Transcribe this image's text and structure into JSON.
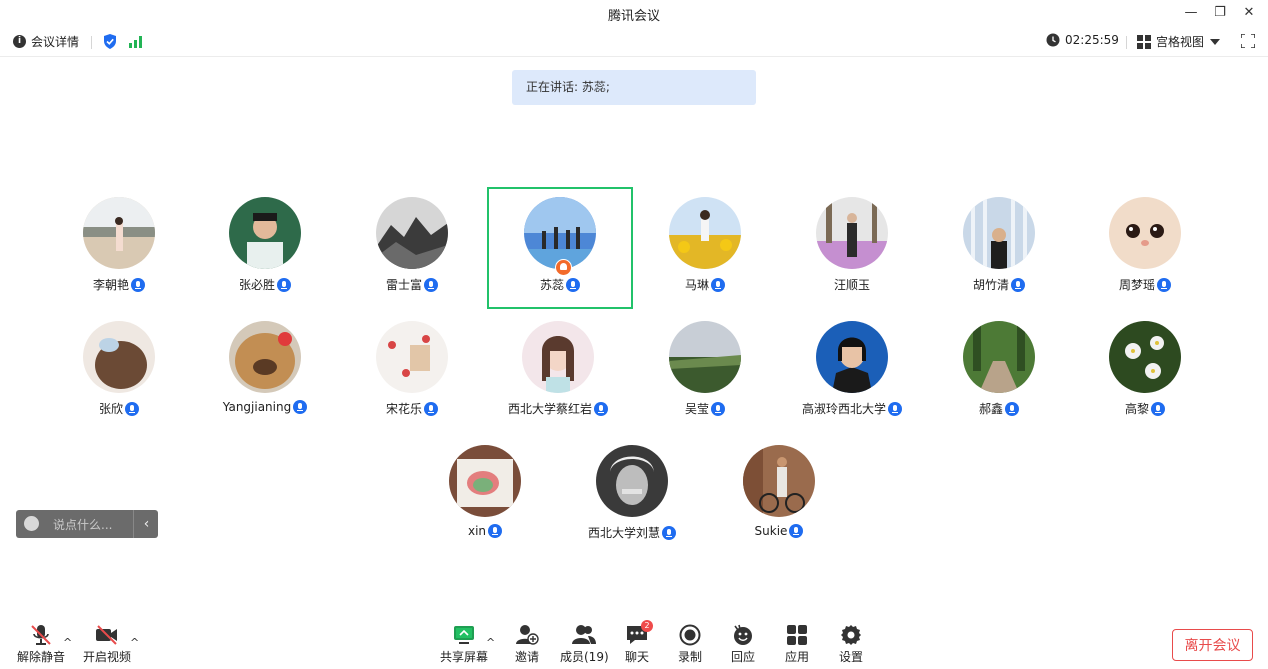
{
  "window": {
    "title": "腾讯会议",
    "minimize": "—",
    "restore": "❐",
    "close": "✕"
  },
  "infobar": {
    "details_label": "会议详情",
    "timer": "02:25:59",
    "view_label": "宫格视图",
    "colors": {
      "shield": "#1f6cf0",
      "signal": "#22b455"
    }
  },
  "speaking": {
    "text": "正在讲话: 苏蕊;"
  },
  "participants": [
    {
      "name": "李朝艳",
      "mic": true
    },
    {
      "name": "张必胜",
      "mic": true
    },
    {
      "name": "雷士富",
      "mic": true
    },
    {
      "name": "苏蕊",
      "mic": true,
      "host": true,
      "active": true
    },
    {
      "name": "马琳",
      "mic": true
    },
    {
      "name": "汪顺玉",
      "mic": false
    },
    {
      "name": "胡竹清",
      "mic": true
    },
    {
      "name": "周梦瑶",
      "mic": true
    },
    {
      "name": "张欣",
      "mic": true
    },
    {
      "name": "Yangjianing",
      "mic": true
    },
    {
      "name": "宋花乐",
      "mic": true
    },
    {
      "name": "西北大学蔡红岩",
      "mic": true
    },
    {
      "name": "吴莹",
      "mic": true
    },
    {
      "name": "高淑玲西北大学",
      "mic": true
    },
    {
      "name": "郝鑫",
      "mic": true
    },
    {
      "name": "高黎",
      "mic": true
    },
    {
      "name": "xin",
      "mic": true
    },
    {
      "name": "西北大学刘慧",
      "mic": true
    },
    {
      "name": "Sukie",
      "mic": true
    }
  ],
  "chat": {
    "placeholder": "说点什么...",
    "collapse": "‹"
  },
  "toolbar": {
    "unmute": "解除静音",
    "start_video": "开启视频",
    "share": "共享屏幕",
    "invite": "邀请",
    "members": "成员(19)",
    "chat": "聊天",
    "chat_badge": "2",
    "record": "录制",
    "react": "回应",
    "apps": "应用",
    "settings": "设置",
    "leave": "离开会议",
    "caret": "^"
  },
  "colors": {
    "active_border": "#21c26a",
    "accent_blue": "#1f6cf0",
    "leave_red": "#e84b4b",
    "banner_bg": "#dde9fb"
  }
}
